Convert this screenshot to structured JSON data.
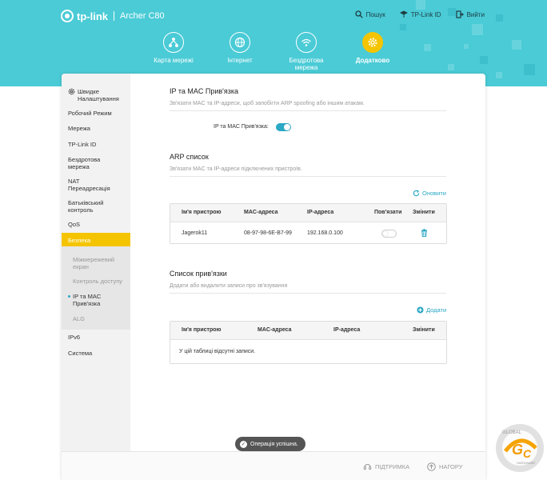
{
  "header": {
    "brand": "tp-link",
    "model": "Archer C80",
    "links": {
      "search": "Пошук",
      "tplink_id": "TP-Link ID",
      "logout": "Вийти"
    },
    "nav": [
      {
        "label": "Карта мережі",
        "icon": "network-map-icon"
      },
      {
        "label": "Інтернет",
        "icon": "globe-icon"
      },
      {
        "label": "Бездротова мережа",
        "icon": "wifi-icon"
      },
      {
        "label": "Додатково",
        "icon": "gear-icon",
        "active": true
      }
    ]
  },
  "sidebar": {
    "items": [
      {
        "label": "Швидке Налаштування"
      },
      {
        "label": "Робочий Режим"
      },
      {
        "label": "Мережа"
      },
      {
        "label": "TP-Link ID"
      },
      {
        "label": "Бездротова мережа"
      },
      {
        "label": "NAT Переадресація"
      },
      {
        "label": "Батьківський контроль"
      },
      {
        "label": "QoS"
      },
      {
        "label": "Безпека",
        "active": true
      },
      {
        "label": "IPv6"
      },
      {
        "label": "Система"
      }
    ],
    "subitems": [
      {
        "label": "Міжмережевий екран"
      },
      {
        "label": "Контроль доступу"
      },
      {
        "label": "IP та MAC Прив'язка",
        "current": true
      },
      {
        "label": "ALG"
      }
    ]
  },
  "binding": {
    "title": "IP та MAC Прив'язка",
    "desc": "Зв'язати MAC та IP-адреси, щоб запобігти ARP spoofing або іншим атакам.",
    "toggle_label": "IP та MAC Прив'язка:",
    "toggle_on": true
  },
  "arp": {
    "title": "ARP список",
    "desc": "Зв'язати MAC та IP-адреси підключених пристроїв.",
    "refresh": "Оновити",
    "columns": [
      "Ім'я пристрою",
      "MAC-адреса",
      "IP-адреса",
      "Пов'язати",
      "Змінити"
    ],
    "rows": [
      {
        "name": "Jagerok11",
        "mac": "08-97-98-6E-B7-99",
        "ip": "192.168.0.100",
        "bound": false
      }
    ]
  },
  "bindlist": {
    "title": "Список прив'язки",
    "desc": "Додати або видалити записи про зв'язування",
    "add": "Додати",
    "columns": [
      "Ім'я пристрою",
      "MAC-адреса",
      "IP-адреса",
      "Змінити"
    ],
    "empty": "У цій таблиці відсутні записи."
  },
  "footer": {
    "support": "ПІДТРИМКА",
    "top": "НАГОРУ"
  },
  "toast": "Операція успішна.",
  "watermark": {
    "top": "GLOBAL",
    "sub": "HARDWARE"
  },
  "colors": {
    "header": "#4acbd6",
    "accent": "#2aa8c4",
    "active": "#f5c400"
  }
}
